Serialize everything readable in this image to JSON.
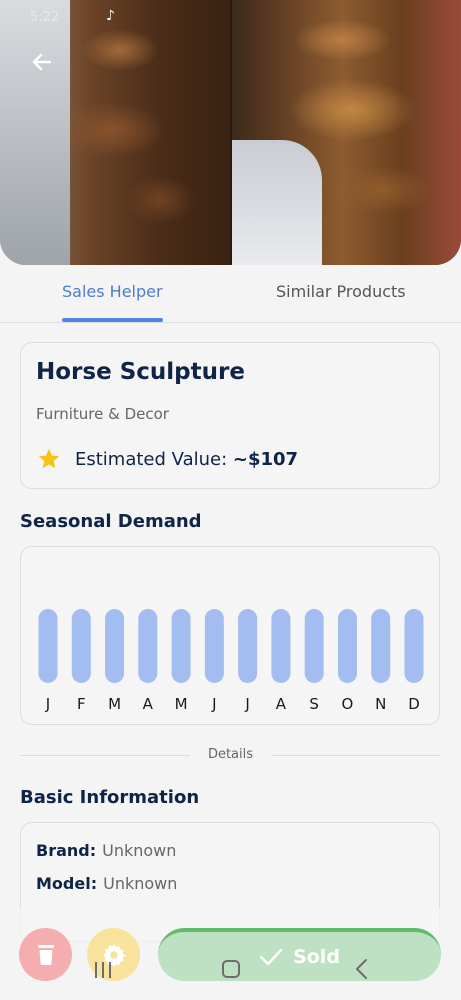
{
  "status_bar": {
    "time": "5:22",
    "app_icon": "tiktok-icon"
  },
  "hero": {
    "back_icon": "arrow-left-icon"
  },
  "tabs": [
    {
      "label": "Sales Helper",
      "active": true
    },
    {
      "label": "Similar Products",
      "active": false
    }
  ],
  "product": {
    "title": "Horse Sculpture",
    "category": "Furniture & Decor",
    "value_label": "Estimated Value: ",
    "value_amount": "~$107",
    "value_icon": "star-icon"
  },
  "seasonal": {
    "title": "Seasonal Demand"
  },
  "chart_data": {
    "type": "bar",
    "categories": [
      "J",
      "F",
      "M",
      "A",
      "M",
      "J",
      "J",
      "A",
      "S",
      "O",
      "N",
      "D"
    ],
    "values": [
      1,
      1,
      1,
      1,
      1,
      1,
      1,
      1,
      1,
      1,
      1,
      1
    ],
    "title": "Seasonal Demand",
    "bar_color": "#a4bdf0",
    "grid": false
  },
  "details_divider": "Details",
  "basic_info": {
    "title": "Basic Information",
    "rows": [
      {
        "key": "Brand:",
        "value": "Unknown"
      },
      {
        "key": "Model:",
        "value": "Unknown"
      }
    ]
  },
  "actions": {
    "delete_icon": "trash-icon",
    "settings_icon": "gear-icon",
    "sold_icon": "checkmark-icon",
    "sold_label": "Sold"
  },
  "colors": {
    "accent": "#4f7ccd",
    "title_text": "#0f2447",
    "delete": "#f4aeb0",
    "settings": "#f9e29c",
    "sold": "#62bb6a"
  }
}
